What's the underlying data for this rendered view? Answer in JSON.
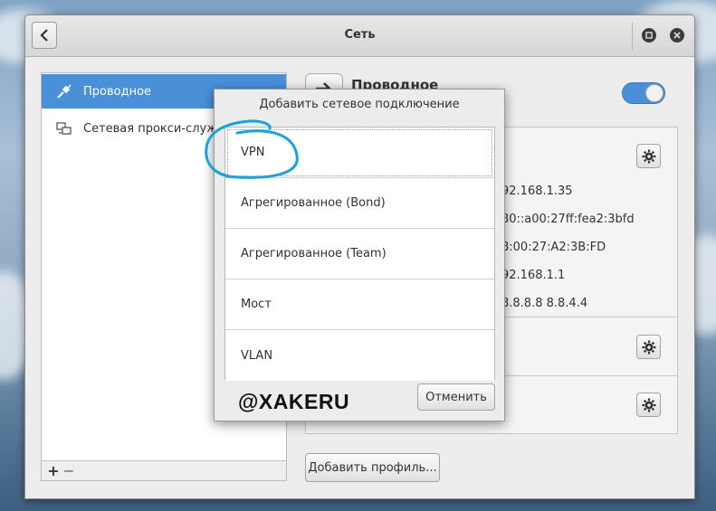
{
  "window": {
    "title": "Сеть",
    "back_icon": "chevron-left-icon",
    "restore_icon": "restore-icon",
    "close_icon": "close-icon"
  },
  "sidebar": {
    "items": [
      {
        "label": "Проводное",
        "icon": "network-wired-icon",
        "selected": true
      },
      {
        "label": "Сетевая прокси-служ",
        "icon": "network-proxy-icon",
        "selected": false
      }
    ],
    "add_label": "+",
    "remove_label": "−"
  },
  "main": {
    "title": "Проводное",
    "toggle_on": true,
    "details": [
      {
        "value": "92.168.1.35"
      },
      {
        "value": "80::a00:27ff:fea2:3bfd"
      },
      {
        "value": "8:00:27:A2:3B:FD"
      },
      {
        "value": "92.168.1.1"
      },
      {
        "value": "8.8.8.8 8.8.4.4"
      }
    ],
    "add_profile_label": "Добавить профиль..."
  },
  "dialog": {
    "title": "Добавить сетевое подключение",
    "options": [
      {
        "label": "VPN"
      },
      {
        "label": "Агрегированное (Bond)"
      },
      {
        "label": "Агрегированное (Team)"
      },
      {
        "label": "Мост"
      },
      {
        "label": "VLAN"
      }
    ],
    "cancel_label": "Отменить"
  },
  "watermark": "@XAKERU",
  "colors": {
    "accent": "#4a90d9",
    "annotation": "#1aa3d8"
  }
}
